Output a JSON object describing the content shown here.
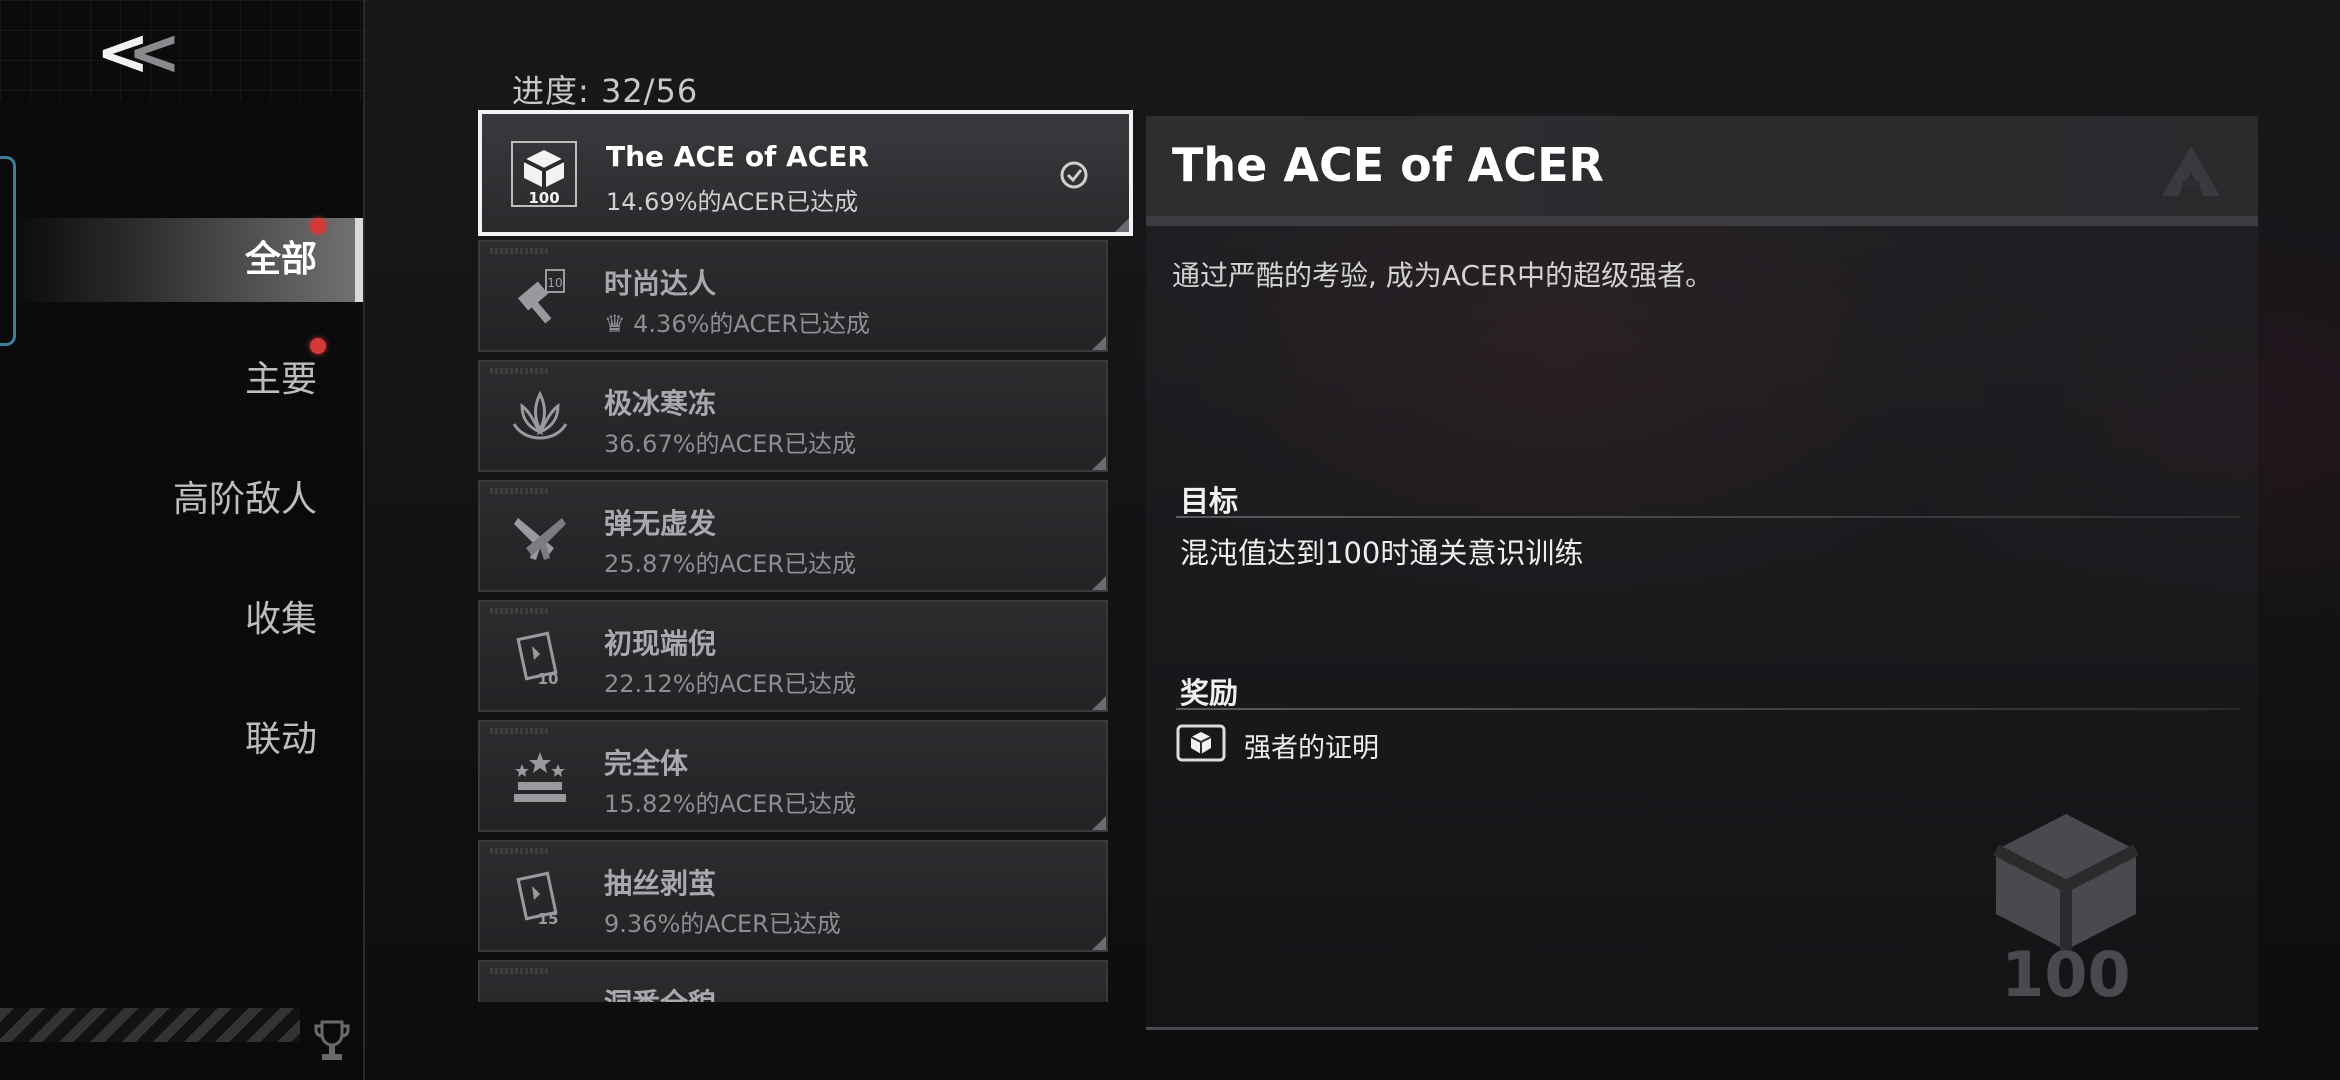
{
  "nav": {
    "back_label": "<<",
    "items": [
      {
        "label": "全部",
        "active": true,
        "badge": true
      },
      {
        "label": "主要",
        "active": false,
        "badge": true
      },
      {
        "label": "高阶敌人",
        "active": false,
        "badge": false
      },
      {
        "label": "收集",
        "active": false,
        "badge": false
      },
      {
        "label": "联动",
        "active": false,
        "badge": false
      }
    ]
  },
  "progress": {
    "label": "进度: 32/56"
  },
  "achievements": [
    {
      "title": "The ACE of ACER",
      "rate": "14.69%的ACER已达成",
      "icon": "ace-100-icon",
      "completed": true
    },
    {
      "title": "时尚达人",
      "rate": "4.36%的ACER已达成",
      "icon": "hammer-10-icon",
      "trophy": true
    },
    {
      "title": "极冰寒冻",
      "rate": "36.67%的ACER已达成",
      "icon": "ice-lotus-icon"
    },
    {
      "title": "弹无虚发",
      "rate": "25.87%的ACER已达成",
      "icon": "crossed-pistols-icon"
    },
    {
      "title": "初现端倪",
      "rate": "22.12%的ACER已达成",
      "icon": "card-10-icon"
    },
    {
      "title": "完全体",
      "rate": "15.82%的ACER已达成",
      "icon": "stars-podium-icon"
    },
    {
      "title": "抽丝剥茧",
      "rate": "9.36%的ACER已达成",
      "icon": "card-15-icon"
    },
    {
      "title": "洞悉全貌",
      "rate": "",
      "icon": "partial-icon"
    }
  ],
  "detail": {
    "title": "The ACE of ACER",
    "description": "通过严酷的考验, 成为ACER中的超级强者。",
    "goal_heading": "目标",
    "goal_text": "混沌值达到100时通关意识训练",
    "reward_heading": "奖励",
    "reward_text": "强者的证明",
    "emblem_number": "100"
  },
  "colors": {
    "accent_frame": "#3f7f9a",
    "badge_red": "#d23a3a",
    "selected_border": "#f2f2f2"
  }
}
